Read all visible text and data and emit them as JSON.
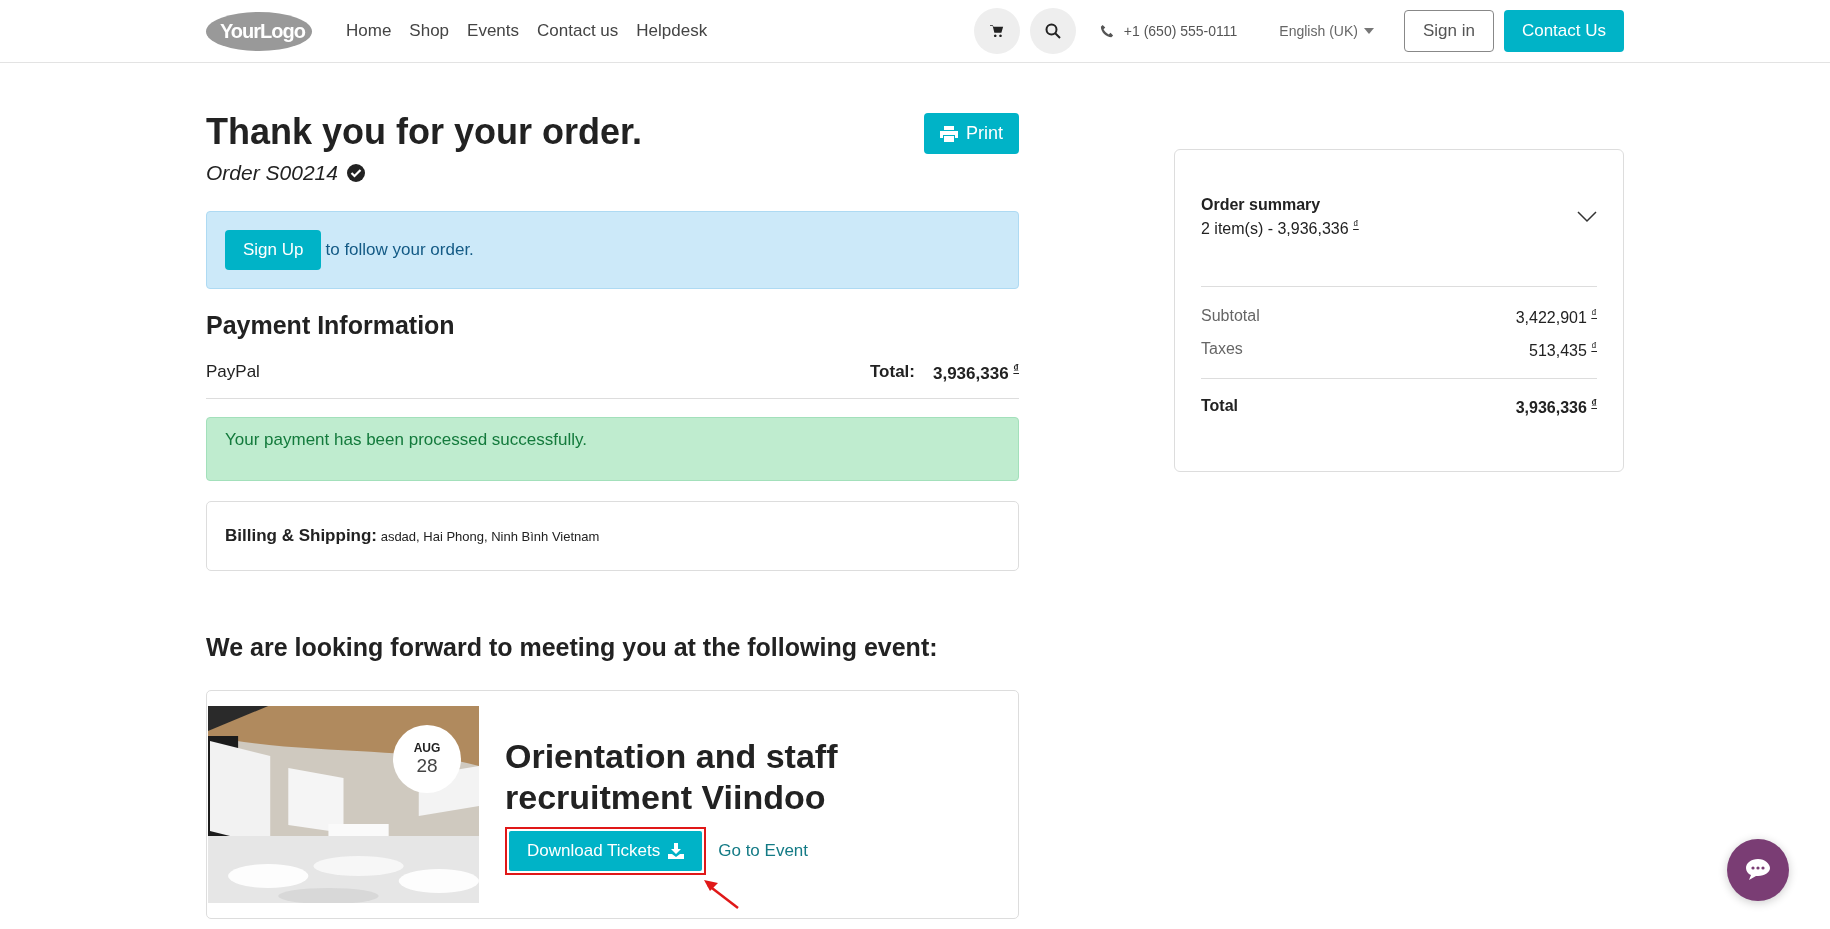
{
  "header": {
    "logo": "YourLogo",
    "nav": [
      {
        "label": "Home"
      },
      {
        "label": "Shop"
      },
      {
        "label": "Events"
      },
      {
        "label": "Contact us"
      },
      {
        "label": "Helpdesk"
      }
    ],
    "phone": "+1 (650) 555-0111",
    "language": "English (UK)",
    "sign_in": "Sign in",
    "contact": "Contact Us"
  },
  "title": "Thank you for your order.",
  "order": "Order S00214",
  "print": "Print",
  "signup": {
    "button": "Sign Up",
    "text": "to follow your order."
  },
  "payment": {
    "heading": "Payment Information",
    "method": "PayPal",
    "total_label": "Total:",
    "total": "3,936,336",
    "currency": "₫"
  },
  "success": "Your payment has been processed successfully.",
  "billing": {
    "label": "Billing & Shipping:",
    "address": "asdad, Hai Phong, Ninh Bình Vietnam"
  },
  "event_heading": "We are looking forward to meeting you at the following event:",
  "event": {
    "month": "AUG",
    "day": "28",
    "title": "Orientation and staff recruitment Viindoo",
    "download": "Download Tickets",
    "go": "Go to Event",
    "highlighted": true
  },
  "summary": {
    "title": "Order summary",
    "items": "2 item(s) - ",
    "amount": "3,936,336",
    "currency": "₫",
    "expanded": false,
    "lines": [
      {
        "label": "Subtotal",
        "amount": "3,422,901",
        "currency": "₫"
      },
      {
        "label": "Taxes",
        "amount": "513,435",
        "currency": "₫"
      }
    ],
    "total": {
      "label": "Total",
      "amount": "3,936,336",
      "currency": "₫"
    }
  }
}
